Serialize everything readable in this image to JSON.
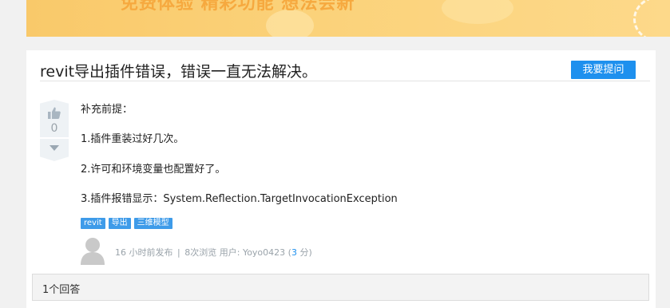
{
  "banner": {
    "text": "免费体验 精彩功能 想法会新"
  },
  "question": {
    "title": "revit导出插件错误，错误一直无法解决。",
    "ask_button": "我要提问",
    "votes": "0",
    "body": [
      "补充前提：",
      "1.插件重装过好几次。",
      "2.许可和环境变量也配置好了。",
      "3.插件报错显示：System.Reflection.TargetInvocationException"
    ],
    "tags": [
      "revit",
      "导出",
      "三维模型"
    ],
    "meta": {
      "posted": "16 小时前发布",
      "separator": "|",
      "views": "8次浏览",
      "user_prefix": "用户:",
      "user": "Yoyo0423",
      "score_open": "(",
      "score": "3",
      "score_unit": "分)"
    }
  },
  "answers": {
    "count_label": "1个回答"
  },
  "colors": {
    "accent": "#1e90ee",
    "tag": "#3e9be9",
    "banner": "#fbd27a"
  }
}
